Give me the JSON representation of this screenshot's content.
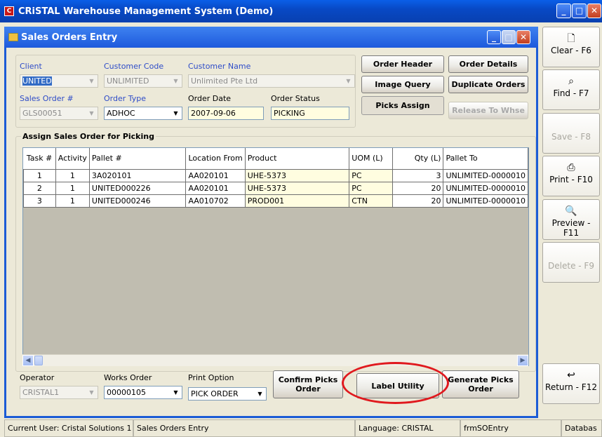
{
  "app_title": "CRiSTAL Warehouse Management System (Demo)",
  "window_title": "Sales Orders Entry",
  "header": {
    "client_label": "Client",
    "client_value": "UNITED",
    "customer_code_label": "Customer Code",
    "customer_code_value": "UNLIMITED",
    "customer_name_label": "Customer Name",
    "customer_name_value": "Unlimited Pte Ltd",
    "sales_order_label": "Sales Order #",
    "sales_order_value": "GLS00051",
    "order_type_label": "Order Type",
    "order_type_value": "ADHOC",
    "order_date_label": "Order Date",
    "order_date_value": "2007-09-06",
    "order_status_label": "Order Status",
    "order_status_value": "PICKING"
  },
  "top_buttons": {
    "order_header": "Order Header",
    "order_details": "Order Details",
    "image_query": "Image Query",
    "duplicate_orders": "Duplicate Orders",
    "picks_assign": "Picks Assign",
    "release_to_whse": "Release To Whse"
  },
  "section_title": "Assign Sales Order for Picking",
  "grid": {
    "columns": [
      "Task #",
      "Activity",
      "Pallet #",
      "Location From",
      "Product",
      "UOM (L)",
      "Qty (L)",
      "Pallet To"
    ],
    "rows": [
      [
        "1",
        "1",
        "3A020101",
        "AA020101",
        "UHE-5373",
        "PC",
        "3",
        "UNLIMITED-0000010"
      ],
      [
        "2",
        "1",
        "UNITED000226",
        "AA020101",
        "UHE-5373",
        "PC",
        "20",
        "UNLIMITED-0000010"
      ],
      [
        "3",
        "1",
        "UNITED000246",
        "AA010702",
        "PROD001",
        "CTN",
        "20",
        "UNLIMITED-0000010"
      ]
    ]
  },
  "footer": {
    "operator_label": "Operator",
    "operator_value": "CRISTAL1",
    "works_order_label": "Works Order",
    "works_order_value": "00000105",
    "print_option_label": "Print Option",
    "print_option_value": "PICK ORDER",
    "confirm_picks": "Confirm Picks Order",
    "label_utility": "Label Utility",
    "generate_picks": "Generate Picks Order"
  },
  "sidebar": [
    {
      "label": "Clear - F6",
      "icon": "document-icon",
      "enabled": true
    },
    {
      "label": "Find - F7",
      "icon": "binoculars-icon",
      "enabled": true
    },
    {
      "label": "Save - F8",
      "icon": "",
      "enabled": false
    },
    {
      "label": "Print - F10",
      "icon": "printer-icon",
      "enabled": true
    },
    {
      "label": "Preview - F11",
      "icon": "preview-icon",
      "enabled": true
    },
    {
      "label": "Delete - F9",
      "icon": "",
      "enabled": false
    },
    {
      "label": "Return - F12",
      "icon": "return-icon",
      "enabled": true
    }
  ],
  "status_bar": {
    "user": "Current User: Cristal Solutions 1",
    "screen": "Sales Orders Entry",
    "language": "Language: CRISTAL",
    "form": "frmSOEntry",
    "database": "Databas"
  },
  "colors": {
    "accent": "#0A5FE8",
    "highlight_oval": "#E0191E",
    "label_blue": "#2E4CC8",
    "cell_yellow": "#FFFDE0"
  }
}
